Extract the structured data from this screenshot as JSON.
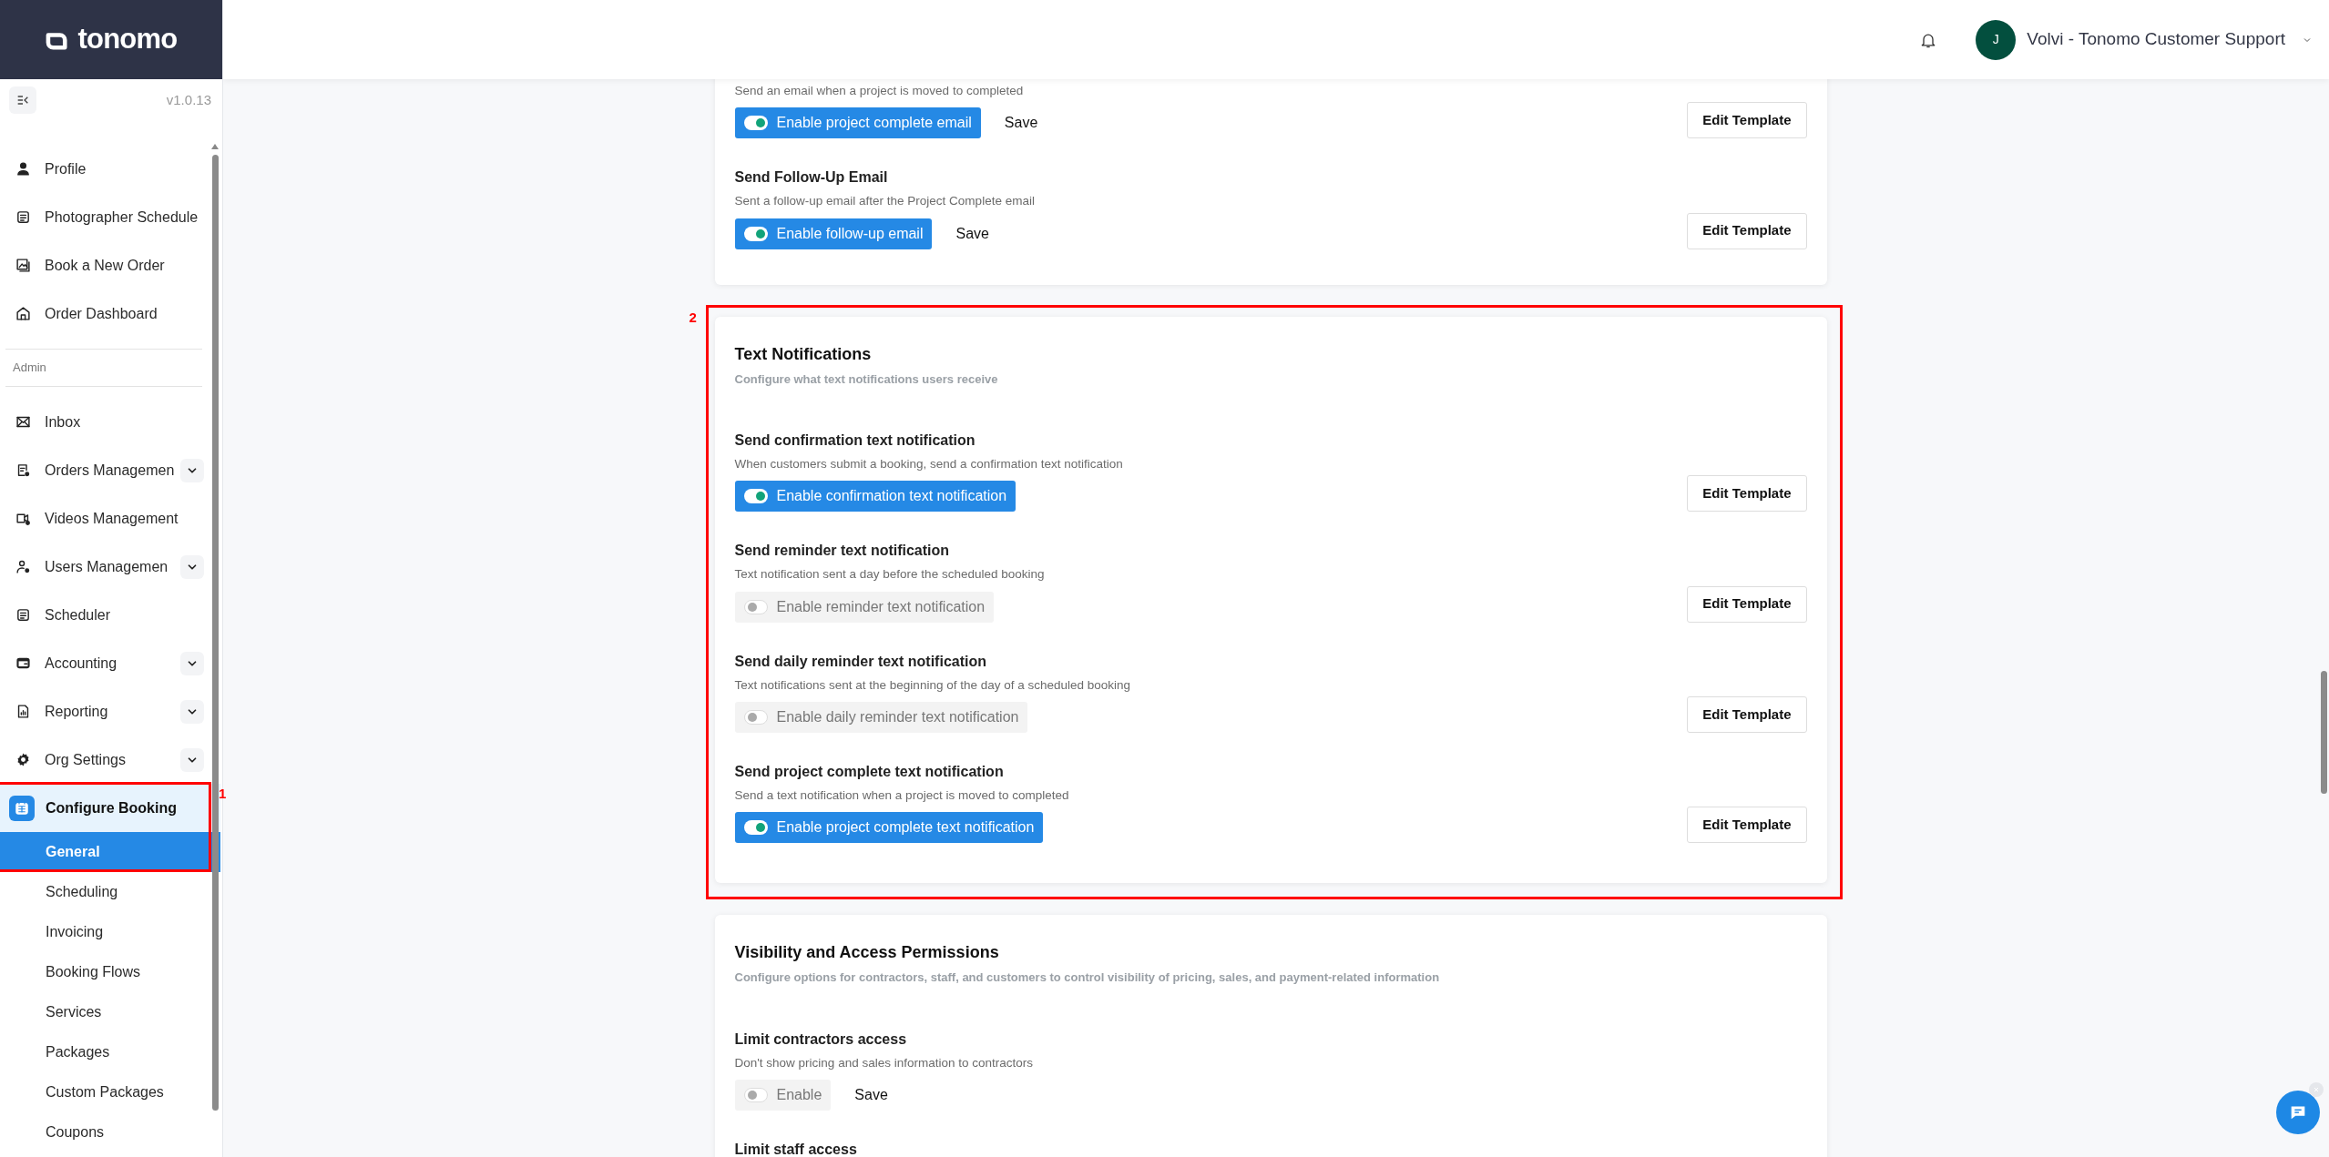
{
  "sidebar": {
    "brand": "tonomo",
    "version": "v1.0.13",
    "main_items": [
      {
        "label": "Profile"
      },
      {
        "label": "Photographer Schedule"
      },
      {
        "label": "Book a New Order"
      },
      {
        "label": "Order Dashboard"
      }
    ],
    "section_label": "Admin",
    "admin_items": [
      {
        "label": "Inbox",
        "has_menu": false
      },
      {
        "label": "Orders Managemen",
        "has_menu": true
      },
      {
        "label": "Videos Management",
        "has_menu": false
      },
      {
        "label": "Users Managemen",
        "has_menu": true
      },
      {
        "label": "Scheduler",
        "has_menu": false
      },
      {
        "label": "Accounting",
        "has_menu": true
      },
      {
        "label": "Reporting",
        "has_menu": true
      },
      {
        "label": "Org Settings",
        "has_menu": true
      }
    ],
    "group": {
      "label": "Configure Booking",
      "expanded": true,
      "annotation": "1",
      "children": [
        {
          "label": "General",
          "selected": true
        },
        {
          "label": "Scheduling",
          "selected": false
        },
        {
          "label": "Invoicing",
          "selected": false
        },
        {
          "label": "Booking Flows",
          "selected": false
        },
        {
          "label": "Services",
          "selected": false
        },
        {
          "label": "Packages",
          "selected": false
        },
        {
          "label": "Custom Packages",
          "selected": false
        },
        {
          "label": "Coupons",
          "selected": false
        }
      ]
    }
  },
  "header": {
    "avatar_initial": "J",
    "user_name": "Volvi - Tonomo Customer Support"
  },
  "cards": [
    {
      "settings": [
        {
          "description": "Send an email when a project is moved to completed",
          "toggle": {
            "label": "Enable project complete email",
            "on": true
          },
          "save": "Save",
          "template_button": "Edit Template"
        },
        {
          "title": "Send Follow-Up Email",
          "description": "Sent a follow-up email after the Project Complete email",
          "toggle": {
            "label": "Enable follow-up email",
            "on": true
          },
          "save": "Save",
          "template_button": "Edit Template"
        }
      ]
    },
    {
      "title": "Text Notifications",
      "subtitle": "Configure what text notifications users receive",
      "annotation": "2",
      "settings": [
        {
          "title": "Send confirmation text notification",
          "description": "When customers submit a booking, send a confirmation text notification",
          "toggle": {
            "label": "Enable confirmation text notification",
            "on": true
          },
          "template_button": "Edit Template"
        },
        {
          "title": "Send reminder text notification",
          "description": "Text notification sent a day before the scheduled booking",
          "toggle": {
            "label": "Enable reminder text notification",
            "on": false
          },
          "template_button": "Edit Template"
        },
        {
          "title": "Send daily reminder text notification",
          "description": "Text notifications sent at the beginning of the day of a scheduled booking",
          "toggle": {
            "label": "Enable daily reminder text notification",
            "on": false
          },
          "template_button": "Edit Template"
        },
        {
          "title": "Send project complete text notification",
          "description": "Send a text notification when a project is moved to completed",
          "toggle": {
            "label": "Enable project complete text notification",
            "on": true
          },
          "template_button": "Edit Template"
        }
      ]
    },
    {
      "title": "Visibility and Access Permissions",
      "subtitle": "Configure options for contractors, staff, and customers to control visibility of pricing, sales, and payment-related information",
      "settings": [
        {
          "title": "Limit contractors access",
          "description": "Don't show pricing and sales information to contractors",
          "toggle": {
            "label": "Enable",
            "on": false
          },
          "save": "Save"
        },
        {
          "title": "Limit staff access"
        }
      ]
    }
  ]
}
